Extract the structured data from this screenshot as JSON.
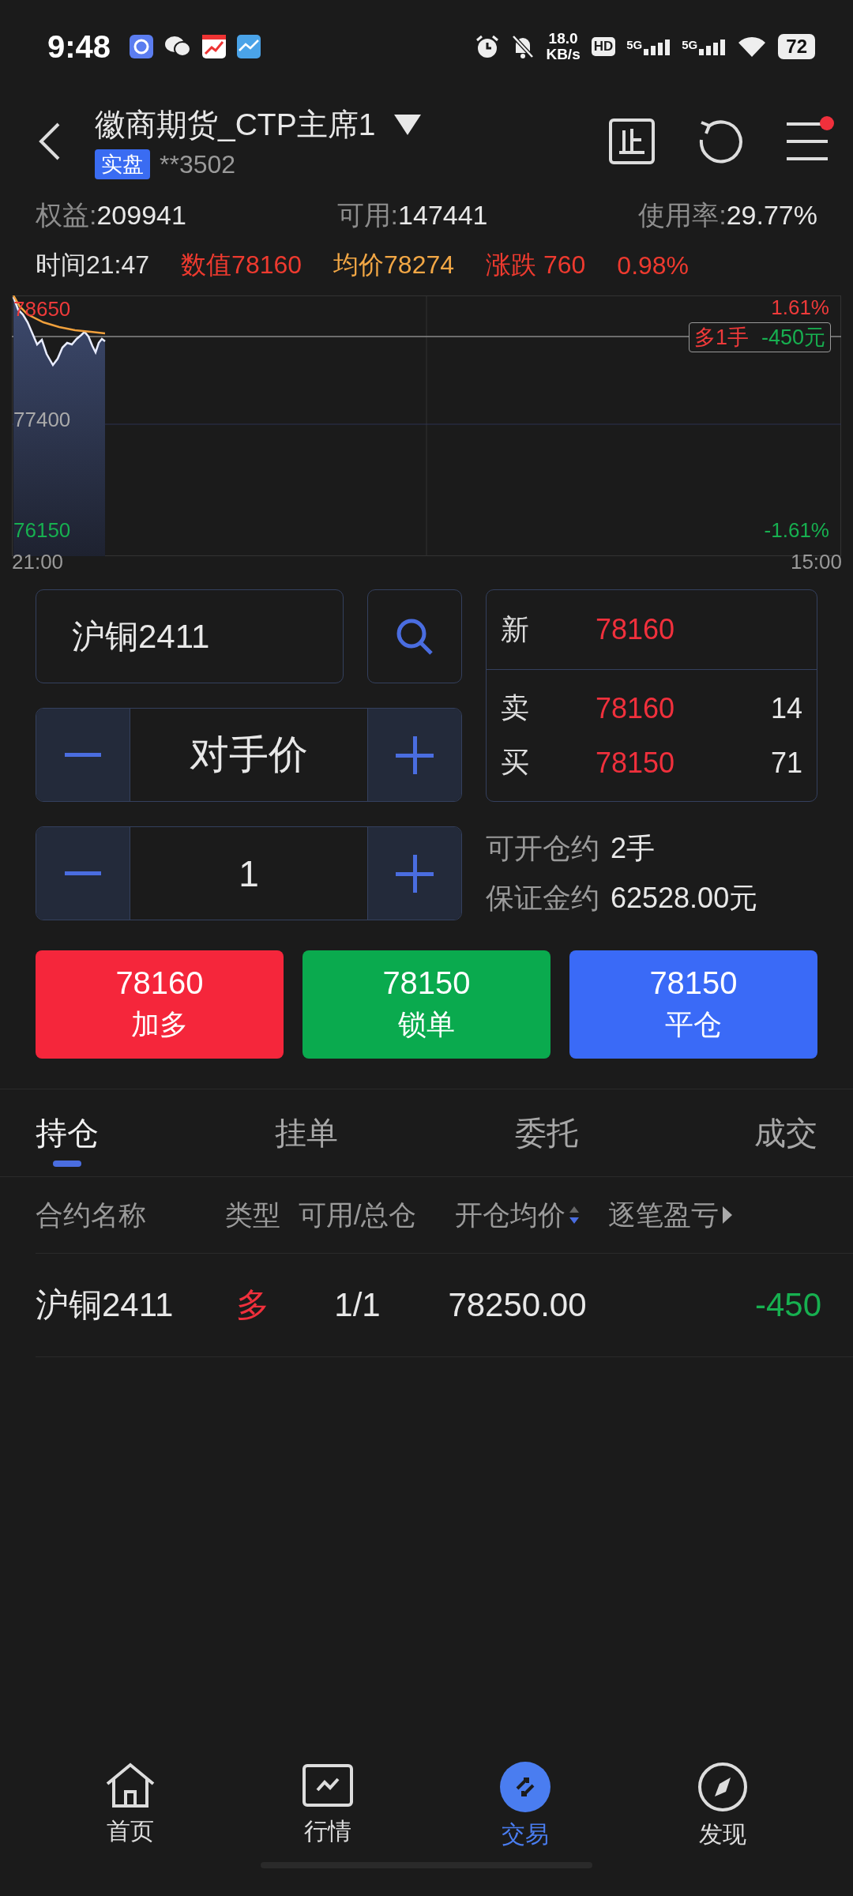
{
  "status_bar": {
    "time": "9:48",
    "net_speed": "18.0",
    "net_unit": "KB/s",
    "hd": "HD",
    "signals": [
      {
        "label": "5G"
      },
      {
        "label": "5G"
      }
    ],
    "battery": "72"
  },
  "header": {
    "title": "徽商期货_CTP主席1",
    "tag": "实盘",
    "account": "**3502",
    "menu_badge": true
  },
  "account_stats": [
    {
      "label": "权益:",
      "value": "209941"
    },
    {
      "label": "可用:",
      "value": "147441"
    },
    {
      "label": "使用率:",
      "value": "29.77%"
    }
  ],
  "quote_info": [
    {
      "text": "时间21:47",
      "color": "#e2e2e2"
    },
    {
      "text": "数值78160",
      "color": "#ee3a2f"
    },
    {
      "text": "均价78274",
      "color": "#f2a745"
    },
    {
      "text": "涨跌 760",
      "color": "#ee3a2f"
    },
    {
      "text": "0.98%",
      "color": "#ee3a2f"
    }
  ],
  "chart": {
    "high_price": "78650",
    "mid_price": "77400",
    "low_price": "76150",
    "high_pct": "1.61%",
    "low_pct": "-1.61%",
    "start_time": "21:00",
    "end_time": "15:00",
    "position_tag": {
      "side": "多1手",
      "pnl": "-450元"
    }
  },
  "order": {
    "symbol": "沪铜2411",
    "price_mode": "对手价",
    "quantity": "1",
    "quote": [
      {
        "label": "新",
        "price": "78160"
      },
      {
        "label": "卖",
        "price": "78160",
        "volume": "14"
      },
      {
        "label": "买",
        "price": "78150",
        "volume": "71"
      }
    ],
    "capacity": [
      {
        "label": "可开仓约",
        "value": "2手"
      },
      {
        "label": "保证金约",
        "value": "62528.00元"
      }
    ]
  },
  "actions": [
    {
      "price": "78160",
      "label": "加多",
      "kind": "buy"
    },
    {
      "price": "78150",
      "label": "锁单",
      "kind": "sell"
    },
    {
      "price": "78150",
      "label": "平仓",
      "kind": "close"
    }
  ],
  "tabs": [
    {
      "label": "持仓",
      "selected": true
    },
    {
      "label": "挂单",
      "selected": false
    },
    {
      "label": "委托",
      "selected": false
    },
    {
      "label": "成交",
      "selected": false
    }
  ],
  "table": {
    "columns": [
      {
        "label": "合约名称"
      },
      {
        "label": "类型"
      },
      {
        "label": "可用/总仓"
      },
      {
        "label": "开仓均价",
        "sorted": true
      },
      {
        "label": "逐笔盈亏",
        "more": true
      }
    ],
    "rows": [
      {
        "cells": [
          {
            "text": "沪铜2411"
          },
          {
            "text": "多",
            "color": "#f0303c"
          },
          {
            "text": "1/1"
          },
          {
            "text": "78250.00"
          },
          {
            "text": "-450",
            "color": "#17b050"
          }
        ]
      }
    ]
  },
  "bottom_nav": [
    {
      "label": "首页",
      "kind": "home",
      "selected": false
    },
    {
      "label": "行情",
      "kind": "market",
      "selected": false
    },
    {
      "label": "交易",
      "kind": "trade",
      "selected": true
    },
    {
      "label": "发现",
      "kind": "discover",
      "selected": false
    }
  ]
}
